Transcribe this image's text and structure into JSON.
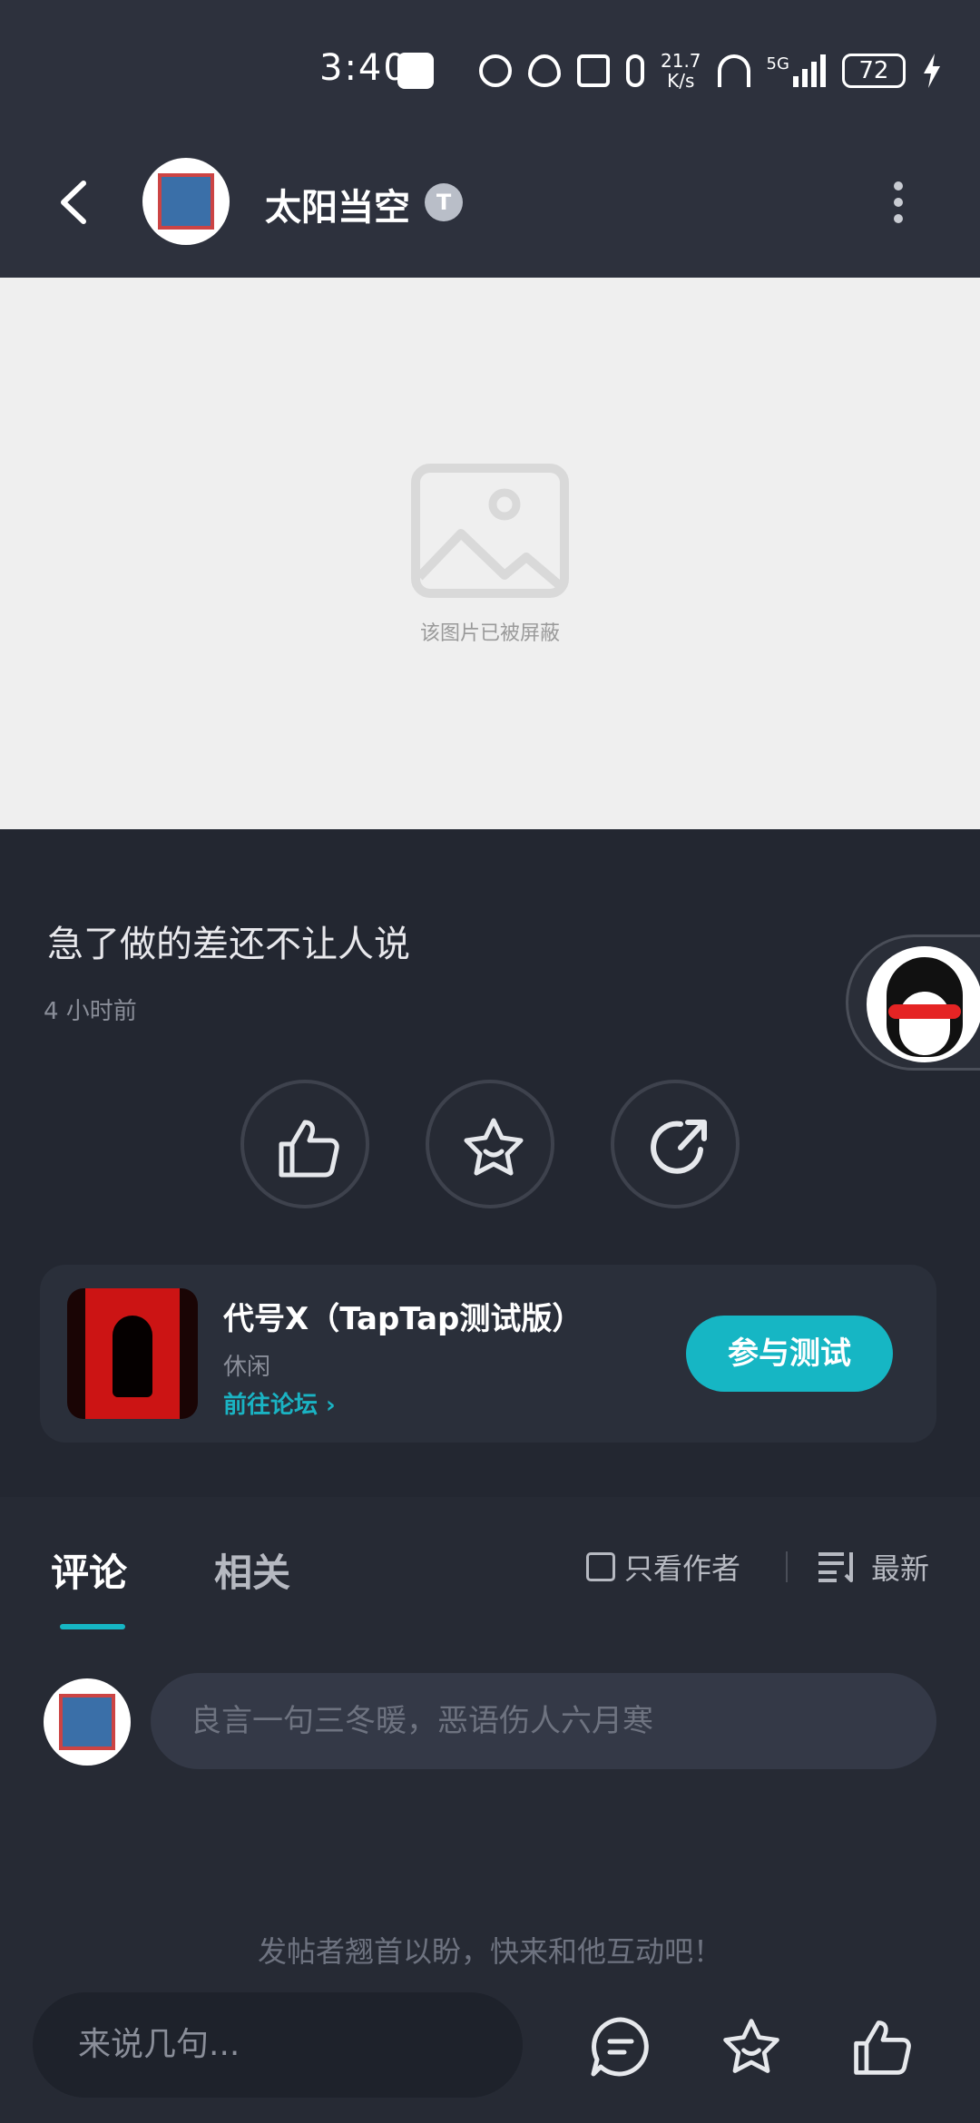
{
  "status_bar": {
    "time": "3:40",
    "speed_top": "21.7",
    "speed_bottom": "K/s",
    "battery": "72",
    "network": "5G"
  },
  "header": {
    "user_name": "太阳当空",
    "level_badge": "T"
  },
  "post": {
    "blocked_image_text": "该图片已被屏蔽",
    "title": "急了做的差还不让人说",
    "time_ago": "4 小时前"
  },
  "game": {
    "name": "代号X（TapTap测试版）",
    "category": "休闲",
    "forum_link": "前往论坛 ›",
    "join_button": "参与测试"
  },
  "comments": {
    "tab_comments": "评论",
    "tab_related": "相关",
    "only_author": "只看作者",
    "sort_label": "最新",
    "input_placeholder": "良言一句三冬暖，恶语伤人六月寒",
    "empty_hint": "发帖者翘首以盼，快来和他互动吧！"
  },
  "bottom_bar": {
    "input_placeholder": "来说几句..."
  },
  "colors": {
    "accent": "#16b6c4",
    "background": "#232731",
    "header": "#2d313d"
  }
}
